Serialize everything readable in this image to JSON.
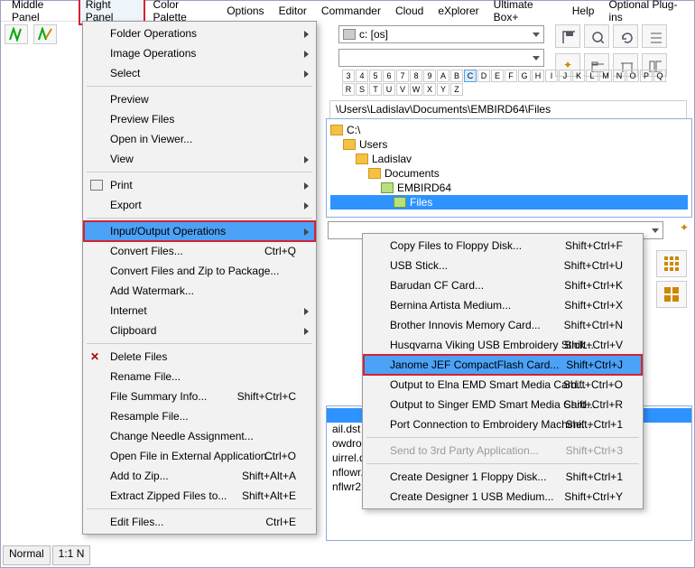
{
  "menubar": [
    "Middle Panel",
    "Right Panel",
    "Color Palette",
    "Options",
    "Editor",
    "Commander",
    "Cloud",
    "eXplorer",
    "Ultimate Box+",
    "Help",
    "Optional Plug-ins"
  ],
  "menubar_hl_index": 1,
  "drive_combo": "c: [os]",
  "letters": [
    "3",
    "4",
    "5",
    "6",
    "7",
    "8",
    "9",
    "A",
    "B",
    "C",
    "D",
    "E",
    "F",
    "G",
    "H",
    "I",
    "J",
    "K",
    "L",
    "M",
    "N",
    "O",
    "P",
    "Q",
    "R",
    "S",
    "T",
    "U",
    "V",
    "W",
    "X",
    "Y",
    "Z"
  ],
  "letter_active": "C",
  "path": "\\Users\\Ladislav\\Documents\\EMBIRD64\\Files",
  "tree": [
    {
      "label": "C:\\",
      "indent": 0,
      "open": false
    },
    {
      "label": "Users",
      "indent": 14,
      "open": false
    },
    {
      "label": "Ladislav",
      "indent": 28,
      "open": false
    },
    {
      "label": "Documents",
      "indent": 42,
      "open": false
    },
    {
      "label": "EMBIRD64",
      "indent": 56,
      "open": true
    },
    {
      "label": "Files",
      "indent": 70,
      "open": true,
      "sel": true
    }
  ],
  "menu1": [
    {
      "t": "Folder Operations",
      "c": true
    },
    {
      "t": "Image Operations",
      "c": true
    },
    {
      "t": "Select",
      "c": true
    },
    {
      "sep": true
    },
    {
      "t": "Preview"
    },
    {
      "t": "Preview Files"
    },
    {
      "t": "Open in Viewer..."
    },
    {
      "t": "View",
      "c": true
    },
    {
      "sep": true
    },
    {
      "t": "Print",
      "c": true,
      "ic": "print"
    },
    {
      "t": "Export",
      "c": true
    },
    {
      "sep": true
    },
    {
      "t": "Input/Output Operations",
      "c": true,
      "sel": true,
      "hl": true
    },
    {
      "t": "Convert Files...",
      "sc": "Ctrl+Q"
    },
    {
      "t": "Convert Files and Zip to Package..."
    },
    {
      "t": "Add Watermark..."
    },
    {
      "t": "Internet",
      "c": true
    },
    {
      "t": "Clipboard",
      "c": true
    },
    {
      "sep": true
    },
    {
      "t": "Delete Files",
      "ic": "x"
    },
    {
      "t": "Rename File..."
    },
    {
      "t": "File Summary Info...",
      "sc": "Shift+Ctrl+C"
    },
    {
      "t": "Resample File..."
    },
    {
      "t": "Change Needle Assignment..."
    },
    {
      "t": "Open File in External Application...",
      "sc": "Ctrl+O"
    },
    {
      "t": "Add to Zip...",
      "sc": "Shift+Alt+A"
    },
    {
      "t": "Extract Zipped Files to...",
      "sc": "Shift+Alt+E"
    },
    {
      "sep": true
    },
    {
      "t": "Edit Files...",
      "sc": "Ctrl+E"
    }
  ],
  "menu2": [
    {
      "t": "Copy Files to Floppy Disk...",
      "sc": "Shift+Ctrl+F"
    },
    {
      "t": "USB Stick...",
      "sc": "Shift+Ctrl+U"
    },
    {
      "t": "Barudan CF Card...",
      "sc": "Shift+Ctrl+K"
    },
    {
      "t": "Bernina Artista Medium...",
      "sc": "Shift+Ctrl+X"
    },
    {
      "t": "Brother Innovis Memory Card...",
      "sc": "Shift+Ctrl+N"
    },
    {
      "t": "Husqvarna Viking USB Embroidery Stick...",
      "sc": "Shift+Ctrl+V"
    },
    {
      "t": "Janome JEF CompactFlash Card...",
      "sc": "Shift+Ctrl+J",
      "sel": true,
      "hl": true
    },
    {
      "t": "Output to Elna EMD Smart Media Card...",
      "sc": "Shift+Ctrl+O"
    },
    {
      "t": "Output to Singer EMD Smart Media Card...",
      "sc": "Shift+Ctrl+R"
    },
    {
      "t": "Port Connection to Embroidery Machine...",
      "sc": "Shift+Ctrl+1"
    },
    {
      "sep": true
    },
    {
      "t": "Send to 3rd Party Application...",
      "sc": "Shift+Ctrl+3",
      "dis": true
    },
    {
      "sep": true
    },
    {
      "t": "Create Designer 1 Floppy Disk...",
      "sc": "Shift+Ctrl+1"
    },
    {
      "t": "Create Designer 1 USB Medium...",
      "sc": "Shift+Ctrl+Y"
    }
  ],
  "filelist": [
    {
      "t": "",
      "sel": true
    },
    {
      "t": "ail.dst"
    },
    {
      "t": "owdrop.dst"
    },
    {
      "t": "uirrel.dst"
    },
    {
      "t": "nflowr.dst"
    },
    {
      "t": "nflwr2.dst"
    }
  ],
  "tabs": [
    "Normal",
    "1:1 N"
  ],
  "colors": {
    "hl": "#d62232",
    "sel": "#4ba2f7"
  }
}
